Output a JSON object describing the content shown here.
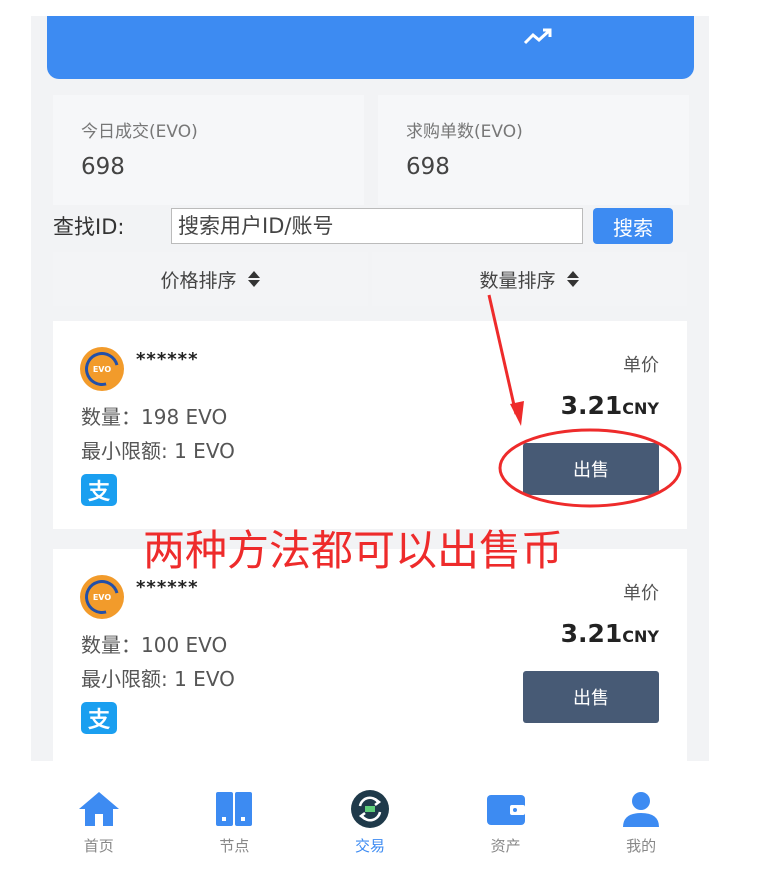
{
  "stats": {
    "today_label": "今日成交(EVO)",
    "today_value": "698",
    "buy_label": "求购单数(EVO)",
    "buy_value": "698"
  },
  "search": {
    "label": "查找ID:",
    "placeholder": "搜索用户ID/账号",
    "button": "搜索"
  },
  "sort": {
    "price": "价格排序",
    "quantity": "数量排序"
  },
  "orders": [
    {
      "user": "******",
      "coin_badge": "EVO",
      "quantity": "数量：198 EVO",
      "min_limit": "最小限额: 1 EVO",
      "unit_label": "单价",
      "price": "3.21",
      "currency": "CNY",
      "action": "出售",
      "payment_icon": "支"
    },
    {
      "user": "******",
      "coin_badge": "EVO",
      "quantity": "数量：100 EVO",
      "min_limit": "最小限额: 1 EVO",
      "unit_label": "单价",
      "price": "3.21",
      "currency": "CNY",
      "action": "出售",
      "payment_icon": "支"
    }
  ],
  "annotation": {
    "text": "两种方法都可以出售币",
    "color": "#ee2b2b"
  },
  "tabbar": {
    "items": [
      {
        "label": "首页",
        "icon": "home-icon"
      },
      {
        "label": "节点",
        "icon": "book-icon"
      },
      {
        "label": "交易",
        "icon": "exchange-icon"
      },
      {
        "label": "资产",
        "icon": "wallet-icon"
      },
      {
        "label": "我的",
        "icon": "user-icon"
      }
    ],
    "active_index": 2
  },
  "colors": {
    "primary": "#3d8bf2",
    "sell_button": "#475a75",
    "alipay": "#1a9ff0",
    "coin": "#f29b2b"
  }
}
